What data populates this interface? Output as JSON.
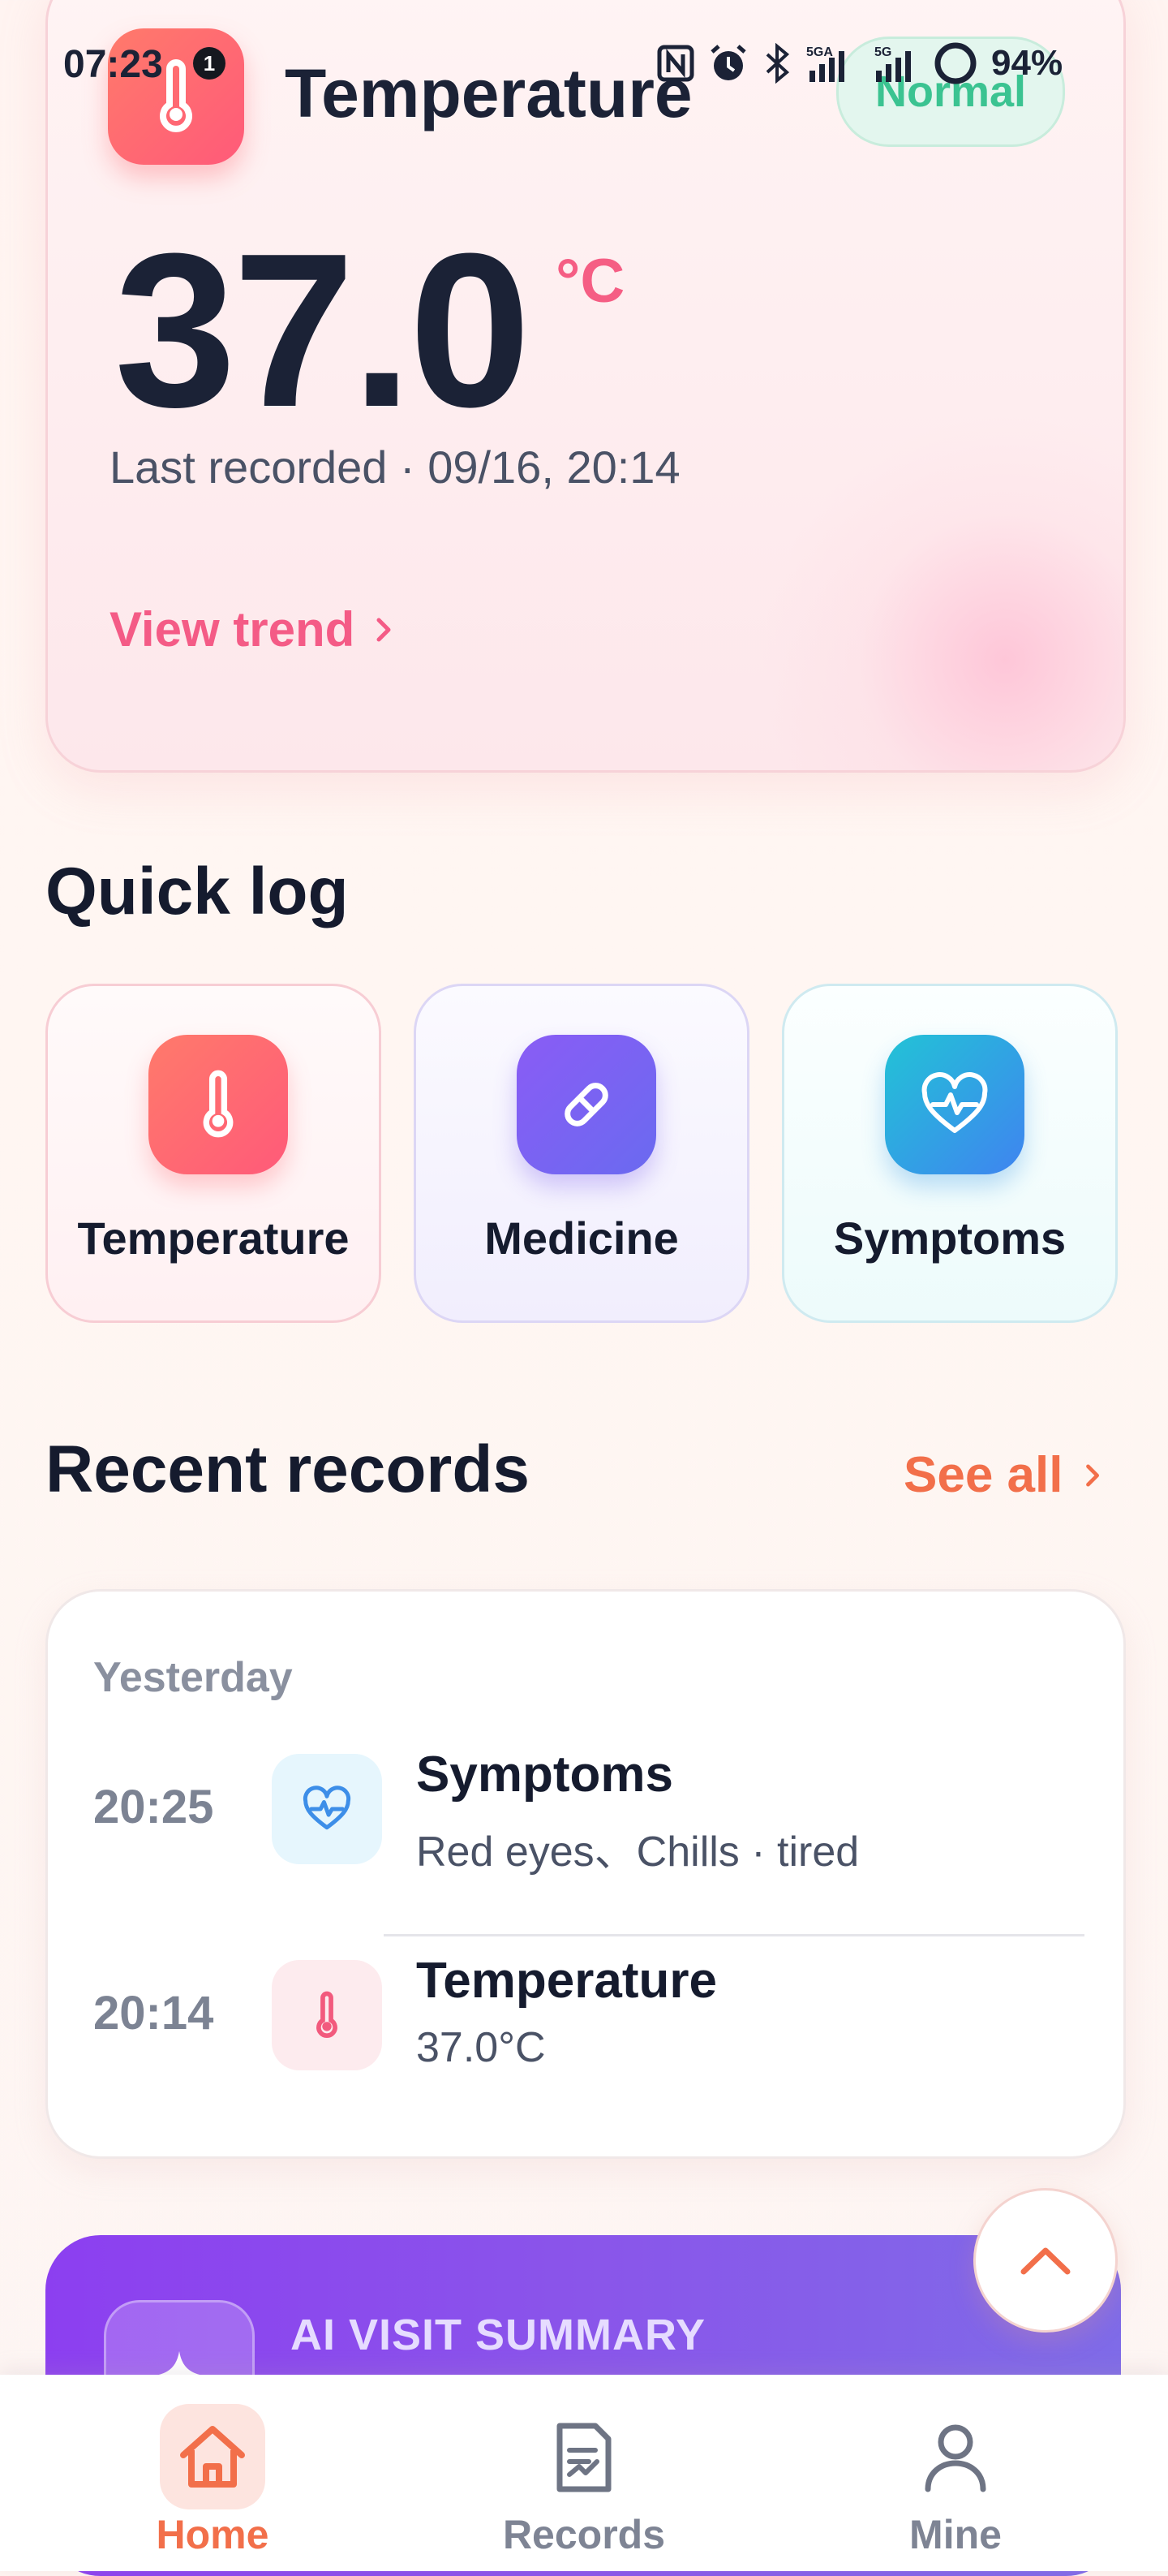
{
  "status_bar": {
    "time": "07:23",
    "notification_count": "1",
    "network_1": "5GA",
    "network_2": "5G",
    "battery": "94%"
  },
  "hero": {
    "title": "Temperature",
    "status": "Normal",
    "value": "37.0",
    "unit": "°C",
    "last_recorded": "Last recorded · 09/16, 20:14",
    "trend_link": "View trend"
  },
  "quick_log": {
    "title": "Quick log",
    "items": [
      {
        "label": "Temperature",
        "icon": "thermometer-icon",
        "color": "#ff6a6f"
      },
      {
        "label": "Medicine",
        "icon": "pill-icon",
        "color": "#7b5cf0"
      },
      {
        "label": "Symptoms",
        "icon": "heart-pulse-icon",
        "color": "#2fb0e0"
      }
    ]
  },
  "recent": {
    "title": "Recent records",
    "see_all": "See all",
    "day": "Yesterday",
    "rows": [
      {
        "time": "20:25",
        "title": "Symptoms",
        "detail": "Red eyes、Chills · tired",
        "icon": "heart-pulse-icon"
      },
      {
        "time": "20:14",
        "title": "Temperature",
        "detail": "37.0°C",
        "icon": "thermometer-icon"
      }
    ]
  },
  "ai_summary": {
    "title": "AI VISIT SUMMARY"
  },
  "nav": [
    {
      "label": "Home",
      "icon": "home-icon",
      "active": true
    },
    {
      "label": "Records",
      "icon": "document-icon",
      "active": false
    },
    {
      "label": "Mine",
      "icon": "person-icon",
      "active": false
    }
  ],
  "colors": {
    "accent": "#f26f4a",
    "pink": "#f45b86",
    "normal_green": "#3bc391",
    "dark": "#151b2e"
  }
}
